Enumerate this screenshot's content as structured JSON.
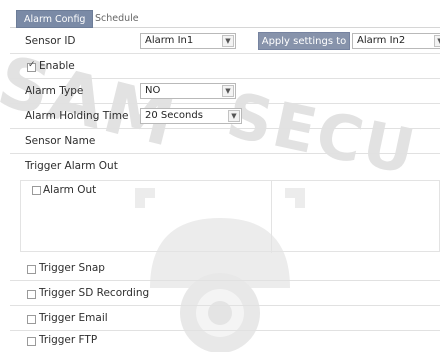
{
  "tabs": [
    {
      "label": "Alarm Config"
    },
    {
      "label": "Schedule"
    }
  ],
  "watermark": {
    "left_text": "SAM",
    "right_text": "SECU"
  },
  "form": {
    "sensor_id": {
      "label": "Sensor ID",
      "value": "Alarm In1"
    },
    "apply_settings": {
      "label": "Apply settings to",
      "value": "Alarm In2"
    },
    "enable": {
      "label": "Enable",
      "checked": true
    },
    "alarm_type": {
      "label": "Alarm Type",
      "value": "NO"
    },
    "alarm_holding_time": {
      "label": "Alarm Holding Time",
      "value": "20 Seconds"
    },
    "sensor_name": {
      "label": "Sensor Name"
    },
    "trigger_alarm_out": {
      "label": "Trigger Alarm Out"
    },
    "alarm_out": {
      "label": "Alarm Out",
      "checked": false
    },
    "trigger_snap": {
      "label": "Trigger Snap",
      "checked": false
    },
    "trigger_sd_recording": {
      "label": "Trigger SD Recording",
      "checked": false
    },
    "trigger_email": {
      "label": "Trigger Email",
      "checked": false
    },
    "trigger_ftp": {
      "label": "Trigger FTP",
      "checked": false
    }
  },
  "colors": {
    "tab_active": "#7a8aa6",
    "button": "#8793ab",
    "watermark": "#e2e2e2"
  },
  "icons": {
    "dropdown": "chevron-down-icon",
    "checkbox": "checkbox-icon"
  }
}
